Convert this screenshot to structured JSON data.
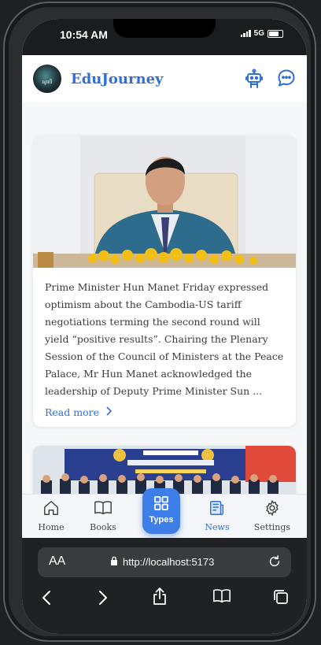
{
  "status_bar": {
    "time": "10:54 AM",
    "network": "5G"
  },
  "app": {
    "title": "EduJourney",
    "logo_text": "ណូបើ",
    "colors": {
      "accent": "#2f6fd6",
      "nav_active": "#3d7ee8"
    },
    "header_icons": [
      "robot-icon",
      "chat-bubble-icon"
    ]
  },
  "feed": {
    "articles": [
      {
        "summary": "Prime Minister Hun Manet Friday expressed optimism about the Cambodia-US tariff negotiations terming the second round will yield “positive results”. Chairing the Plenary Session of the Council of Ministers at the Peace Palace, Mr Hun Manet acknowledged the leadership of Deputy Prime Minister Sun ...",
        "read_more": "Read more"
      }
    ]
  },
  "bottom_nav": {
    "items": [
      {
        "label": "Home",
        "icon": "home-icon"
      },
      {
        "label": "Books",
        "icon": "book-icon"
      },
      {
        "label": "Types",
        "icon": "grid-icon"
      },
      {
        "label": "News",
        "icon": "newspaper-icon",
        "active": true
      },
      {
        "label": "Settings",
        "icon": "gear-icon"
      }
    ]
  },
  "browser": {
    "text_size_label": "AA",
    "url": "http://localhost:5173",
    "toolbar_icons": [
      "back-icon",
      "forward-icon",
      "share-icon",
      "bookmarks-icon",
      "tabs-icon"
    ]
  }
}
